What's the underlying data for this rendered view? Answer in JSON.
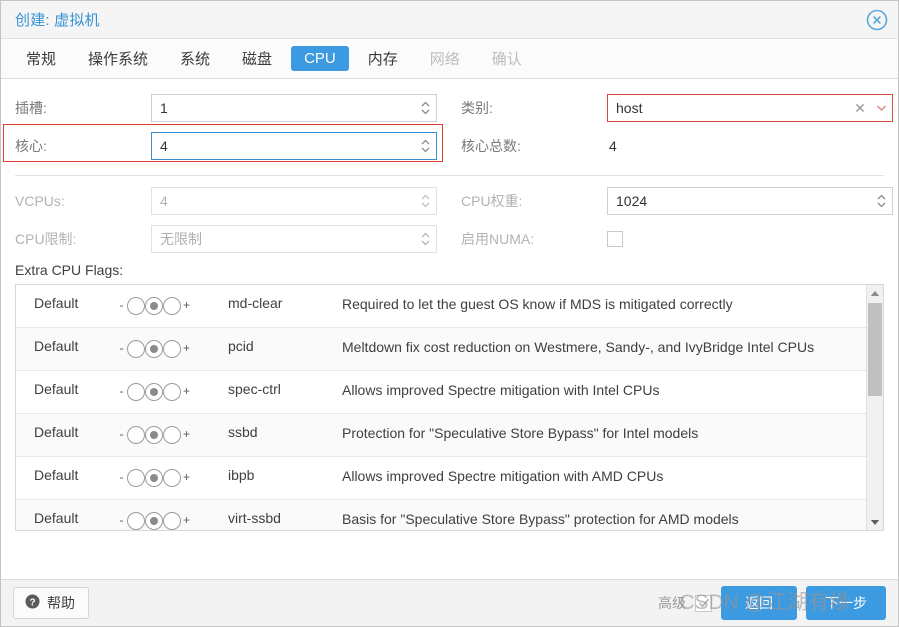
{
  "window": {
    "title": "创建: 虚拟机",
    "close_icon": "close-circle-icon"
  },
  "tabs": [
    {
      "label": "常规",
      "state": "enabled"
    },
    {
      "label": "操作系统",
      "state": "enabled"
    },
    {
      "label": "系统",
      "state": "enabled"
    },
    {
      "label": "磁盘",
      "state": "enabled"
    },
    {
      "label": "CPU",
      "state": "active"
    },
    {
      "label": "内存",
      "state": "enabled"
    },
    {
      "label": "网络",
      "state": "disabled"
    },
    {
      "label": "确认",
      "state": "disabled"
    }
  ],
  "form": {
    "sockets": {
      "label": "插槽:",
      "value": "1"
    },
    "cores": {
      "label": "核心:",
      "value": "4"
    },
    "type": {
      "label": "类别:",
      "value": "host"
    },
    "total_cores": {
      "label": "核心总数:",
      "value": "4"
    },
    "vcpus": {
      "label": "VCPUs:",
      "value": "4"
    },
    "cpu_limit": {
      "label": "CPU限制:",
      "value": "无限制"
    },
    "cpu_weight": {
      "label": "CPU权重:",
      "value": "1024"
    },
    "enable_numa": {
      "label": "启用NUMA:",
      "checked": false
    }
  },
  "flags": {
    "section_label": "Extra CPU Flags:",
    "state_label": "Default",
    "minus": "-",
    "plus": "+",
    "rows": [
      {
        "state": "Default",
        "name": "md-clear",
        "desc": "Required to let the guest OS know if MDS is mitigated correctly"
      },
      {
        "state": "Default",
        "name": "pcid",
        "desc": "Meltdown fix cost reduction on Westmere, Sandy-, and IvyBridge Intel CPUs"
      },
      {
        "state": "Default",
        "name": "spec-ctrl",
        "desc": "Allows improved Spectre mitigation with Intel CPUs"
      },
      {
        "state": "Default",
        "name": "ssbd",
        "desc": "Protection for \"Speculative Store Bypass\" for Intel models"
      },
      {
        "state": "Default",
        "name": "ibpb",
        "desc": "Allows improved Spectre mitigation with AMD CPUs"
      },
      {
        "state": "Default",
        "name": "virt-ssbd",
        "desc": "Basis for \"Speculative Store Bypass\" protection for AMD models"
      }
    ]
  },
  "footer": {
    "help_label": "帮助",
    "help_icon": "question-circle-icon",
    "advanced_label": "高级",
    "advanced_checked": true,
    "back_label": "返回",
    "next_label": "下一步"
  },
  "watermark": "CSDN @江湖有缘",
  "colors": {
    "accent": "#3c9ae0",
    "title": "#3892d4",
    "highlight_red": "#e03b2f",
    "focus_blue": "#3c8ed0"
  }
}
